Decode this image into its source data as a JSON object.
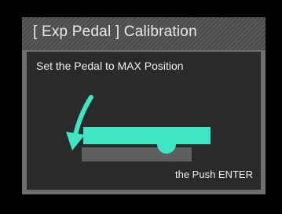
{
  "dialog": {
    "title": "[ Exp Pedal ] Calibration",
    "instruction": "Set the Pedal to MAX Position",
    "prompt": "the Push ENTER"
  },
  "icons": {
    "arrow": "curved-arrow-down-icon",
    "pedal": "expression-pedal-icon"
  },
  "colors": {
    "accent": "#3ee6c4",
    "pedal_base": "#5e5e5e",
    "panel_bg": "#2a2a2a",
    "frame": "#6e6e6e"
  }
}
